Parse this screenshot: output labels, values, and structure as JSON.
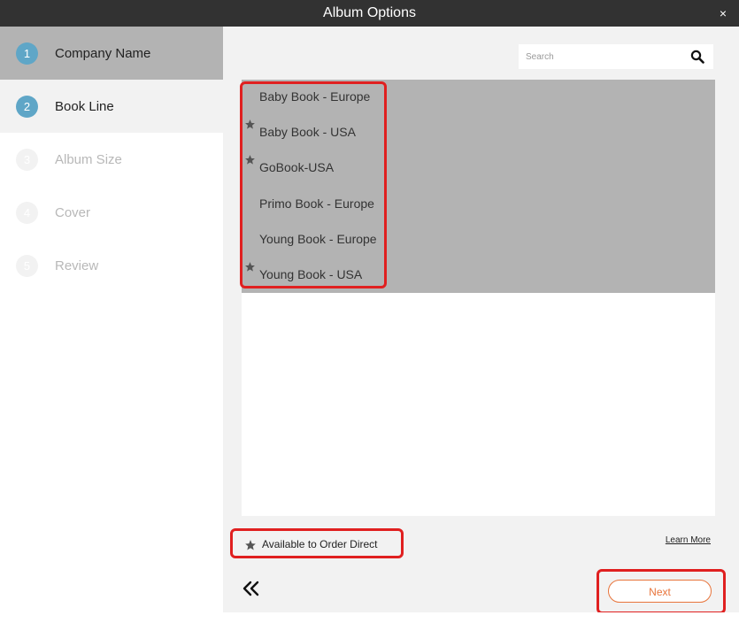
{
  "window": {
    "title": "Album Options",
    "close_label": "×"
  },
  "steps": [
    {
      "number": "1",
      "label": "Company Name"
    },
    {
      "number": "2",
      "label": "Book Line"
    },
    {
      "number": "3",
      "label": "Album Size"
    },
    {
      "number": "4",
      "label": "Cover"
    },
    {
      "number": "5",
      "label": "Review"
    }
  ],
  "search": {
    "placeholder": "Search",
    "value": ""
  },
  "book_lines": [
    {
      "label": "Baby Book - Europe",
      "starred": false
    },
    {
      "label": "Baby Book - USA",
      "starred": true
    },
    {
      "label": "GoBook-USA",
      "starred": true
    },
    {
      "label": "Primo Book - Europe",
      "starred": false
    },
    {
      "label": "Young Book - Europe",
      "starred": false
    },
    {
      "label": "Young Book - USA",
      "starred": true
    }
  ],
  "legend": {
    "label": "Available to Order Direct",
    "icon": "star-icon"
  },
  "learn_more": "Learn More",
  "next_label": "Next",
  "colors": {
    "titlebar": "#323232",
    "selected": "#b3b3b3",
    "step_circle": "#5fa6c7",
    "accent": "#e8743b",
    "highlight": "#e02020"
  }
}
